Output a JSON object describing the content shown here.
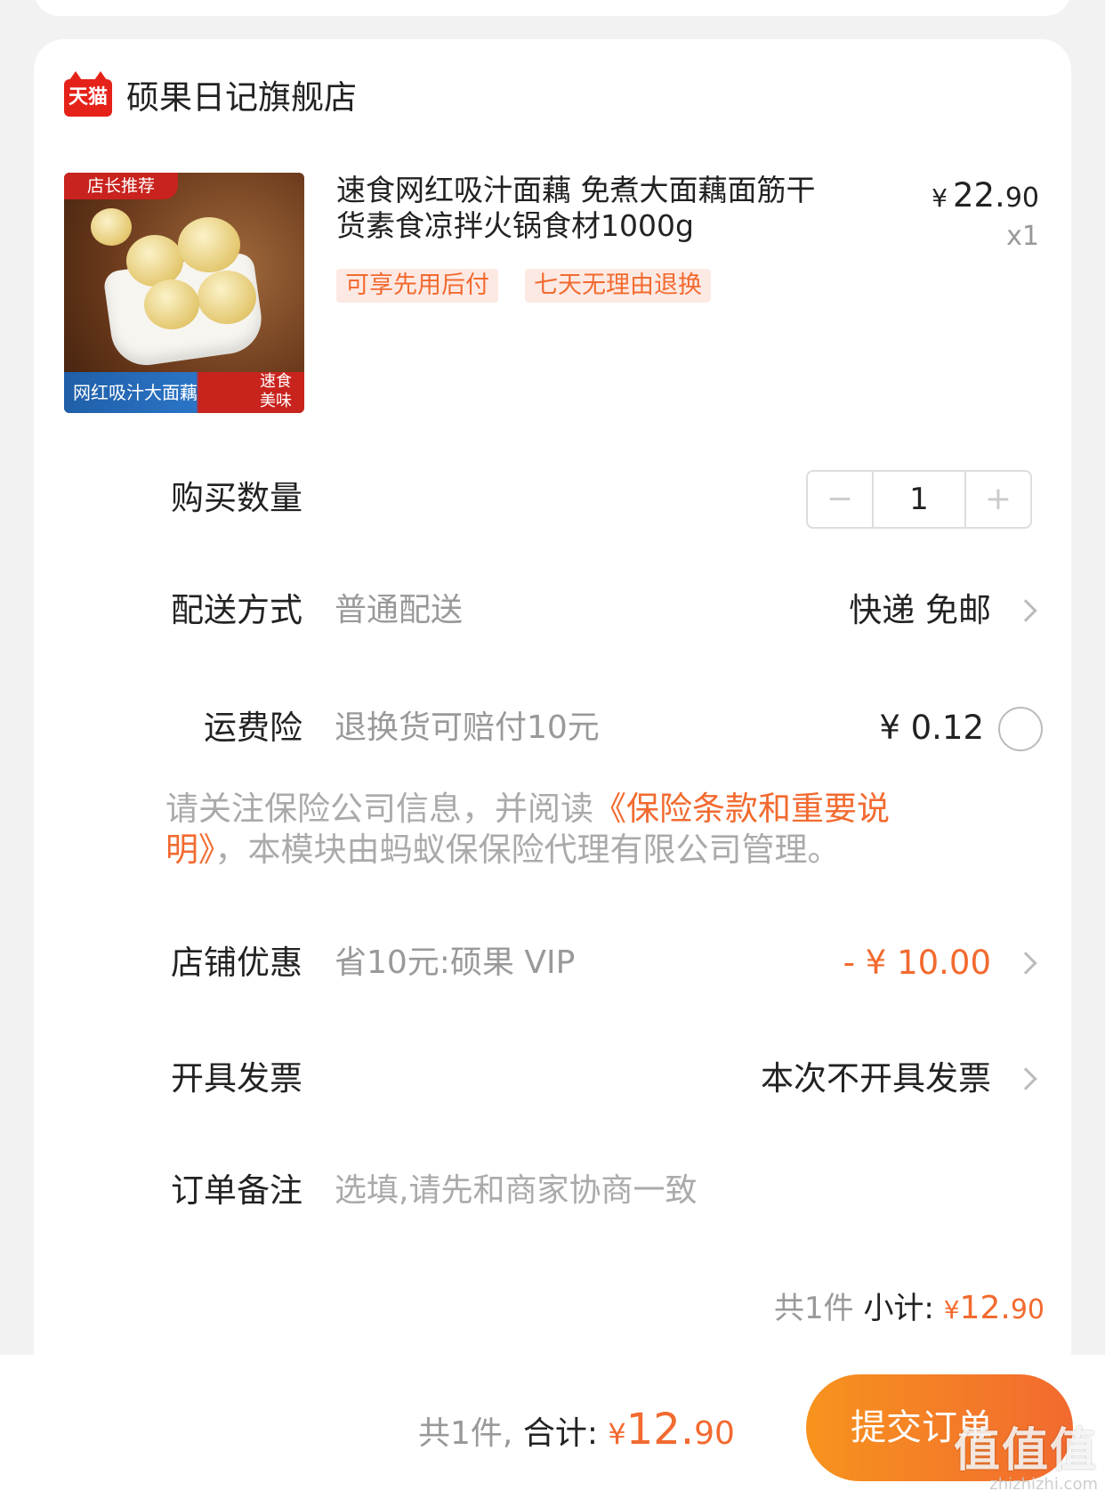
{
  "shop": {
    "logo_text": "天猫",
    "name": "硕果日记旗舰店"
  },
  "product": {
    "image_tag_top": "店长推荐",
    "image_tag_bottom": "网红吸汁大面藕",
    "image_tag_side_1": "速食",
    "image_tag_side_2": "美味",
    "title_line1": "速食网红吸汁面藕 免煮大面藕面筋干",
    "title_line2": "货素食凉拌火锅食材1000g",
    "price_symbol": "¥",
    "price_int": "22.",
    "price_dec": "90",
    "quantity_text": "x1",
    "tags": [
      "可享先用后付",
      "七天无理由退换"
    ]
  },
  "rows": {
    "quantity": {
      "label": "购买数量",
      "value": "1",
      "minus": "−",
      "plus": "+"
    },
    "delivery": {
      "label": "配送方式",
      "sub": "普通配送",
      "value": "快递 免邮"
    },
    "insurance": {
      "label": "运费险",
      "sub": "退换货可赔付10元",
      "value": "¥ 0.12"
    },
    "notice": {
      "prefix": "请关注保险公司信息，并阅读",
      "link": "《保险条款和重要说明》",
      "suffix": "，本模块由蚂蚁保保险代理有限公司管理。"
    },
    "discount": {
      "label": "店铺优惠",
      "sub": "省10元:硕果 VIP",
      "value": "- ¥ 10.00"
    },
    "invoice": {
      "label": "开具发票",
      "value": "本次不开具发票"
    },
    "remark": {
      "label": "订单备注",
      "placeholder": "选填,请先和商家协商一致"
    }
  },
  "subtotal": {
    "count_text": "共1件",
    "label": "小计:",
    "symbol": "¥",
    "int": "12.",
    "dec": "90"
  },
  "footer": {
    "count_text": "共1件,",
    "label": "合计:",
    "symbol": "¥",
    "int": "12.",
    "dec": "90",
    "submit_label": "提交订单"
  },
  "watermark": {
    "big": "值值值",
    "small": "zhizhizhi.com"
  },
  "colors": {
    "accent": "#f26a2f",
    "brand_red": "#e5221a",
    "button_gradient_start": "#f7931e"
  }
}
